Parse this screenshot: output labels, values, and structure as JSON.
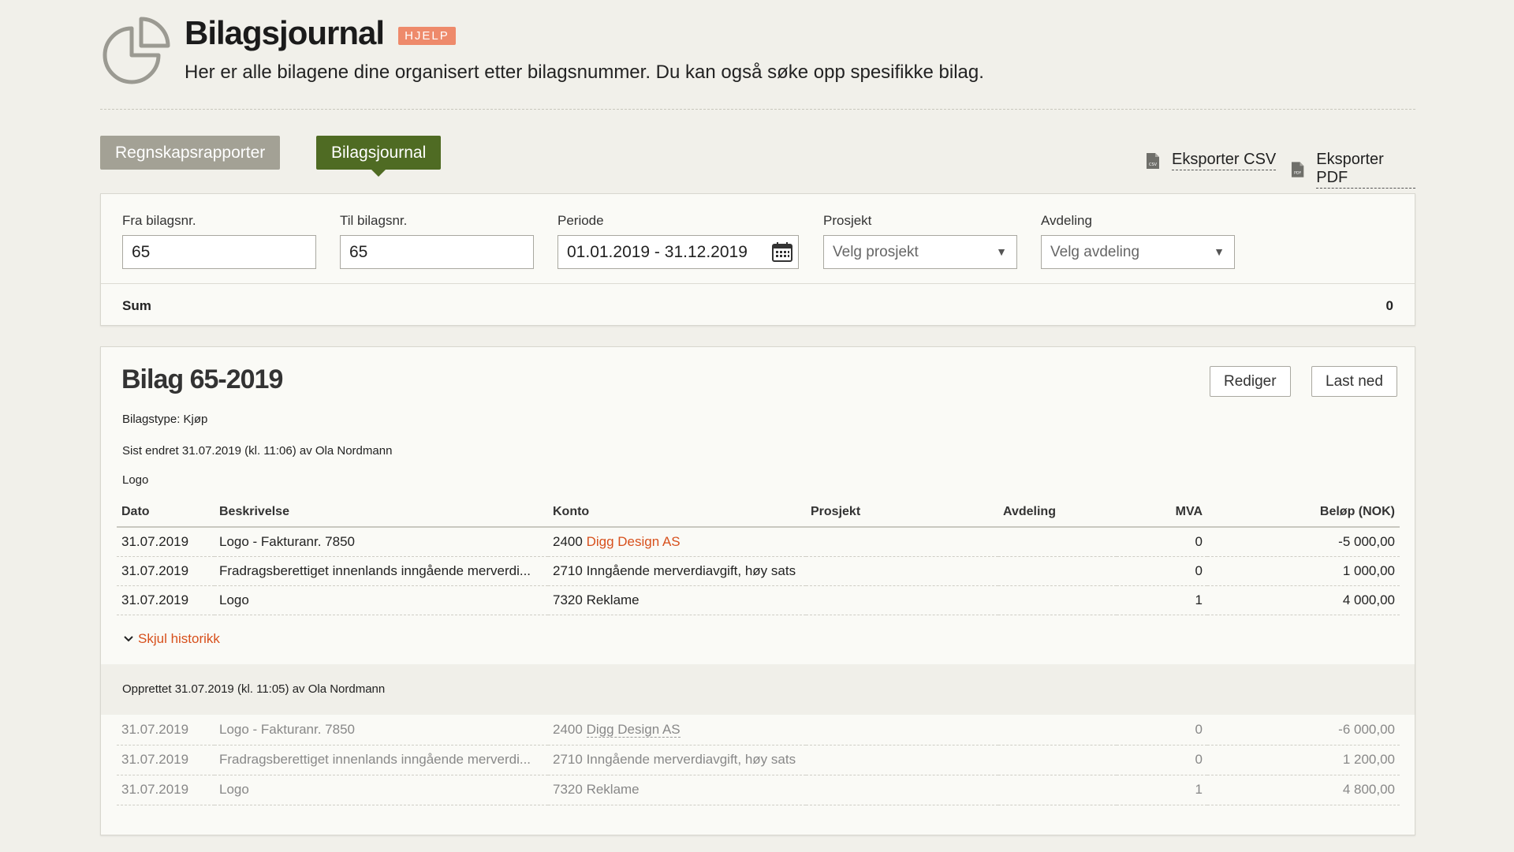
{
  "header": {
    "title": "Bilagsjournal",
    "help_badge": "HJELP",
    "subtitle": "Her er alle bilagene dine organisert etter bilagsnummer. Du kan også søke opp spesifikke bilag."
  },
  "tabs": [
    {
      "label": "Regnskapsrapporter"
    },
    {
      "label": "Bilagsjournal",
      "active": true
    }
  ],
  "export": {
    "csv_label": "Eksporter CSV",
    "csv_icon_text": "CSV",
    "pdf_label": "Eksporter PDF",
    "pdf_icon_text": "PDF"
  },
  "filters": {
    "from": {
      "label": "Fra bilagsnr.",
      "value": "65"
    },
    "to": {
      "label": "Til bilagsnr.",
      "value": "65"
    },
    "period": {
      "label": "Periode",
      "value": "01.01.2019 - 31.12.2019"
    },
    "project": {
      "label": "Prosjekt",
      "value": "Velg prosjekt"
    },
    "department": {
      "label": "Avdeling",
      "value": "Velg avdeling"
    }
  },
  "sum": {
    "label": "Sum",
    "value": "0"
  },
  "voucher": {
    "title": "Bilag 65-2019",
    "edit_label": "Rediger",
    "download_label": "Last ned",
    "type": "Bilagstype: Kjøp",
    "last_changed": "Sist endret 31.07.2019 (kl. 11:06) av Ola Nordmann",
    "description": "Logo",
    "columns": {
      "date": "Dato",
      "description": "Beskrivelse",
      "account": "Konto",
      "project": "Prosjekt",
      "department": "Avdeling",
      "vat": "MVA",
      "amount": "Beløp (NOK)"
    },
    "rows": [
      {
        "date": "31.07.2019",
        "description": "Logo - Fakturanr. 7850",
        "account_no": "2400",
        "account_name": "Digg Design AS",
        "vat": "0",
        "amount": "-5 000,00"
      },
      {
        "date": "31.07.2019",
        "description": "Fradragsberettiget innenlands inngående merverdi...",
        "account_no": "2710",
        "account_name": "Inngående merverdiavgift, høy sats",
        "vat": "0",
        "amount": "1 000,00"
      },
      {
        "date": "31.07.2019",
        "description": "Logo",
        "account_no": "7320",
        "account_name": "Reklame",
        "vat": "1",
        "amount": "4 000,00"
      }
    ],
    "toggle_history": "Skjul historikk",
    "history": {
      "created": "Opprettet 31.07.2019 (kl. 11:05) av Ola Nordmann",
      "rows": [
        {
          "date": "31.07.2019",
          "description": "Logo - Fakturanr. 7850",
          "account_no": "2400",
          "account_name": "Digg Design AS",
          "vat": "0",
          "amount": "-6 000,00"
        },
        {
          "date": "31.07.2019",
          "description": "Fradragsberettiget innenlands inngående merverdi...",
          "account_no": "2710",
          "account_name": "Inngående merverdiavgift, høy sats",
          "vat": "0",
          "amount": "1 200,00"
        },
        {
          "date": "31.07.2019",
          "description": "Logo",
          "account_no": "7320",
          "account_name": "Reklame",
          "vat": "1",
          "amount": "4 800,00"
        }
      ]
    }
  },
  "colors": {
    "accent_green": "#4f6b23",
    "tab_grey": "#a3a195",
    "link_orange": "#d7501c",
    "help_badge": "#ee8a6b"
  }
}
